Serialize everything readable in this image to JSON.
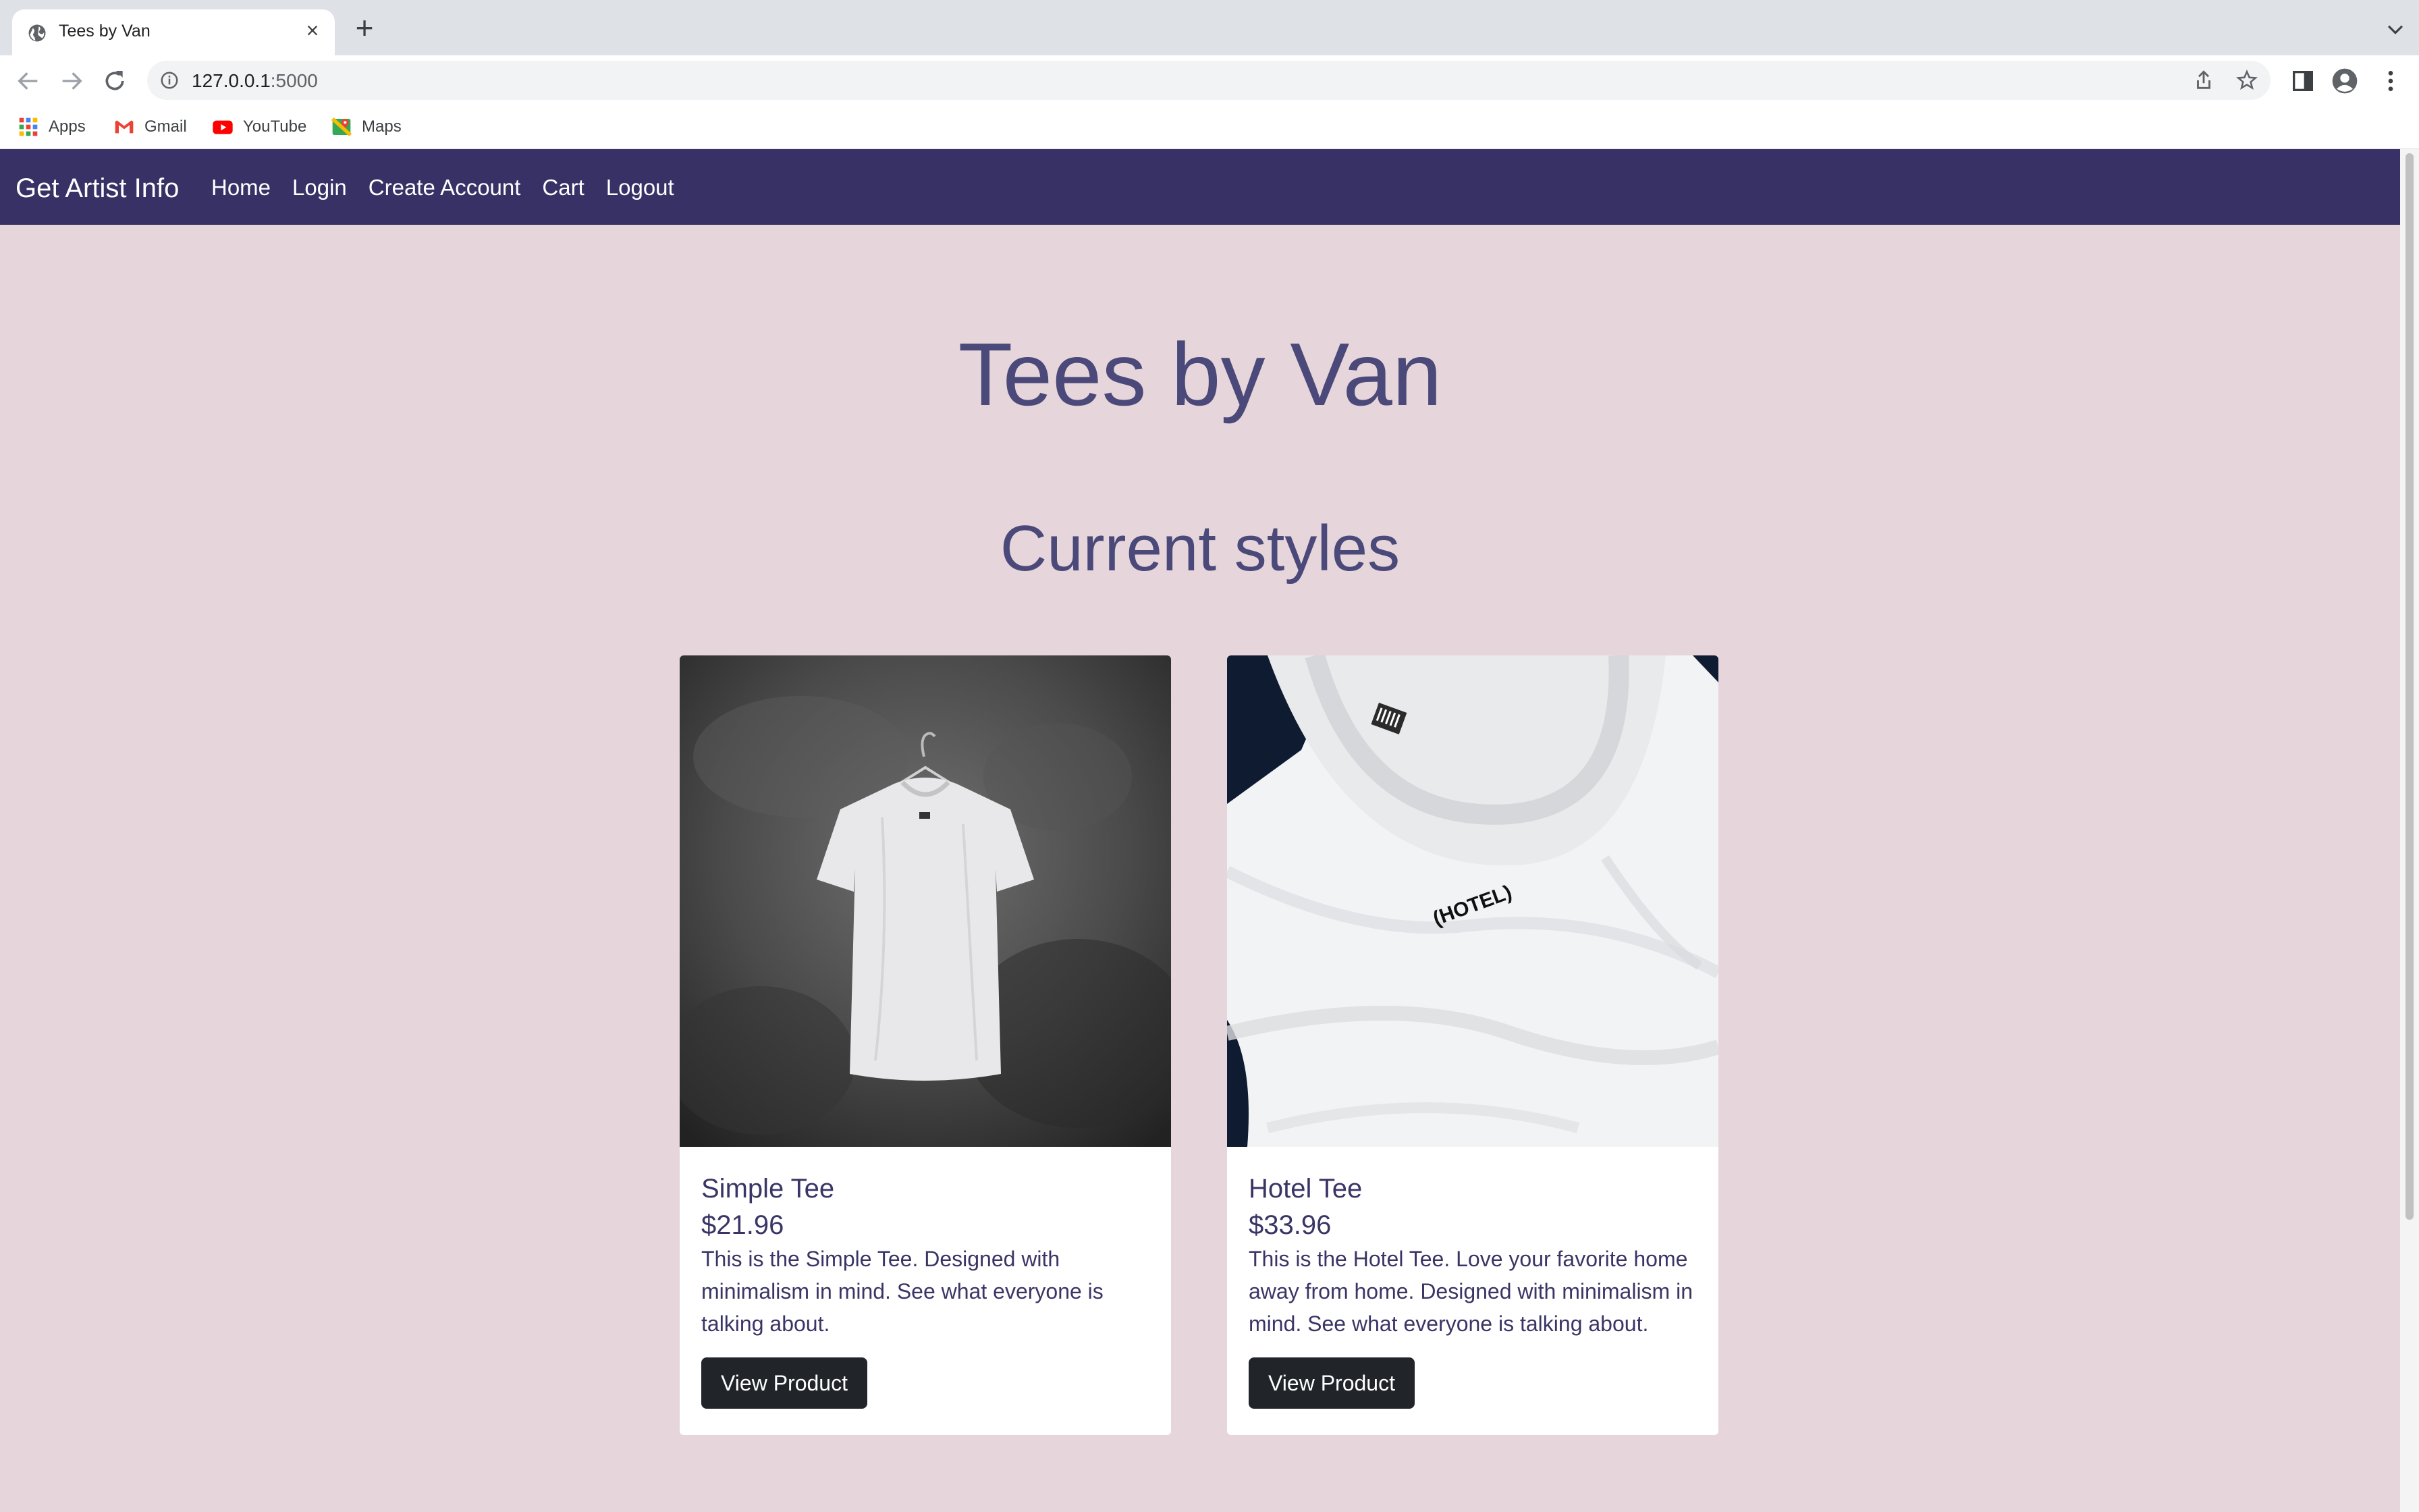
{
  "browser": {
    "tab_title": "Tees by Van",
    "url_host": "127.0.0.1",
    "url_port": ":5000",
    "bookmarks": [
      "Apps",
      "Gmail",
      "YouTube",
      "Maps"
    ]
  },
  "navbar": {
    "brand": "Get Artist Info",
    "links": [
      "Home",
      "Login",
      "Create Account",
      "Cart",
      "Logout"
    ]
  },
  "hero": {
    "title": "Tees by Van",
    "subtitle": "Current styles"
  },
  "products": [
    {
      "name": "Simple Tee",
      "price": "$21.96",
      "description": "This is the Simple Tee. Designed with minimalism in mind. See what everyone is talking about.",
      "button": "View Product",
      "print_text": ""
    },
    {
      "name": "Hotel Tee",
      "price": "$33.96",
      "description": "This is the Hotel Tee. Love your favorite home away from home. Designed with minimalism in mind. See what everyone is talking about.",
      "button": "View Product",
      "print_text": "(HOTEL)"
    }
  ],
  "colors": {
    "navbar": "#373166",
    "page_bg": "#e6d5da",
    "heading": "#4b4979",
    "button": "#212529"
  }
}
